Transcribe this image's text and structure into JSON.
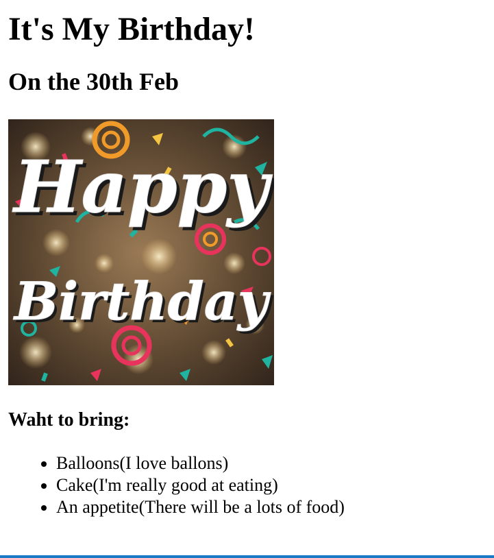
{
  "page": {
    "title": "It's My Birthday!",
    "subtitle": "On the 30th Feb",
    "image": {
      "text_line1": "Happy",
      "text_line2": "Birthday",
      "accent_colors": [
        "#e8345c",
        "#1fb3a0",
        "#f09a2a",
        "#f4c542"
      ]
    },
    "bring_heading": "Waht to bring:",
    "bring_items": [
      "Balloons(I love ballons)",
      "Cake(I'm really good at eating)",
      "An appetite(There will be a lots of food)"
    ]
  },
  "theme": {
    "bottom_rule_color": "#1a7ac8"
  }
}
